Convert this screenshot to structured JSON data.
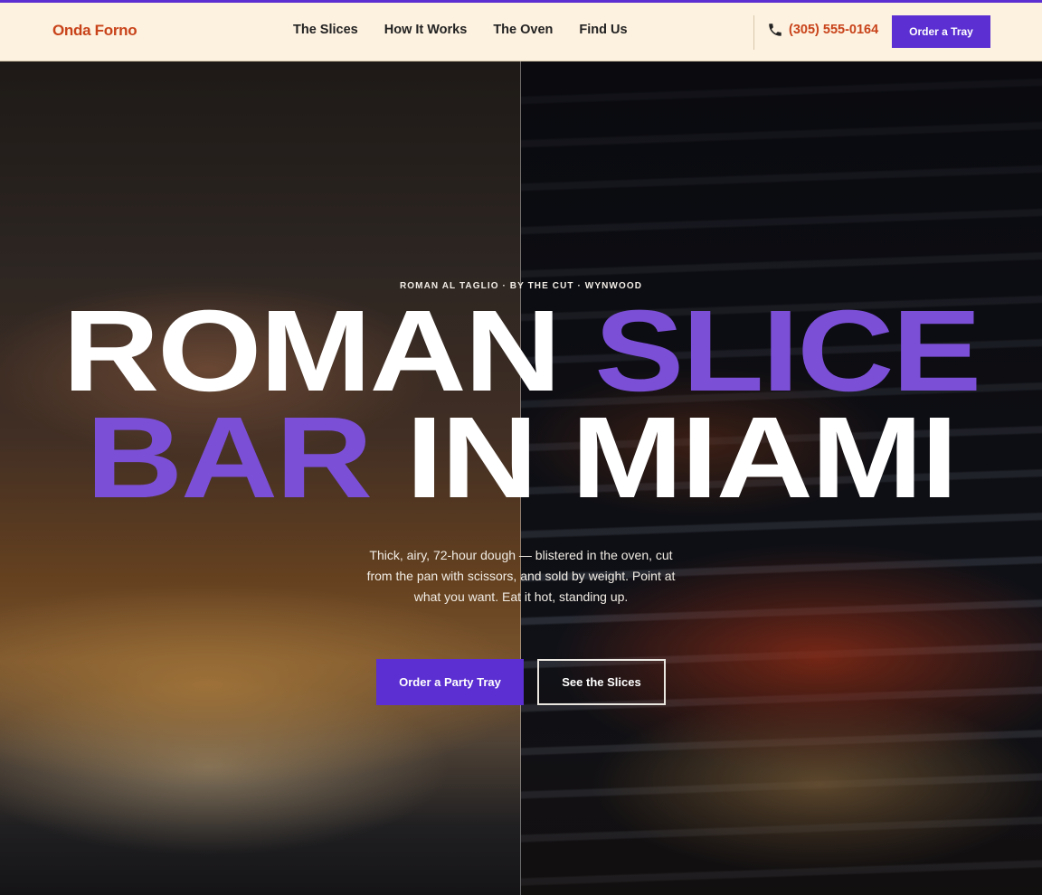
{
  "header": {
    "logo": "Onda Forno",
    "nav": [
      {
        "label": "The Slices"
      },
      {
        "label": "How It Works"
      },
      {
        "label": "The Oven"
      },
      {
        "label": "Find Us"
      }
    ],
    "phone": "(305) 555-0164",
    "order_button": "Order a Tray"
  },
  "hero": {
    "eyebrow": "ROMAN AL TAGLIO · BY THE CUT · WYNWOOD",
    "headline": {
      "line1_white": "ROMAN",
      "line1_purple": "SLICE",
      "line2_purple": "BAR",
      "line2_white": "IN MIAMI"
    },
    "subtitle": "Thick, airy, 72-hour dough — blistered in the oven, cut from the pan with scissors, and sold by weight. Point at what you want. Eat it hot, standing up.",
    "primary_cta": "Order a Party Tray",
    "secondary_cta": "See the Slices"
  },
  "colors": {
    "accent": "#5b2fd1",
    "headline_purple": "#7b4fd6",
    "brand_orange": "#c8431a",
    "header_bg": "#fdf1df"
  },
  "icons": {
    "phone": "phone-icon"
  }
}
